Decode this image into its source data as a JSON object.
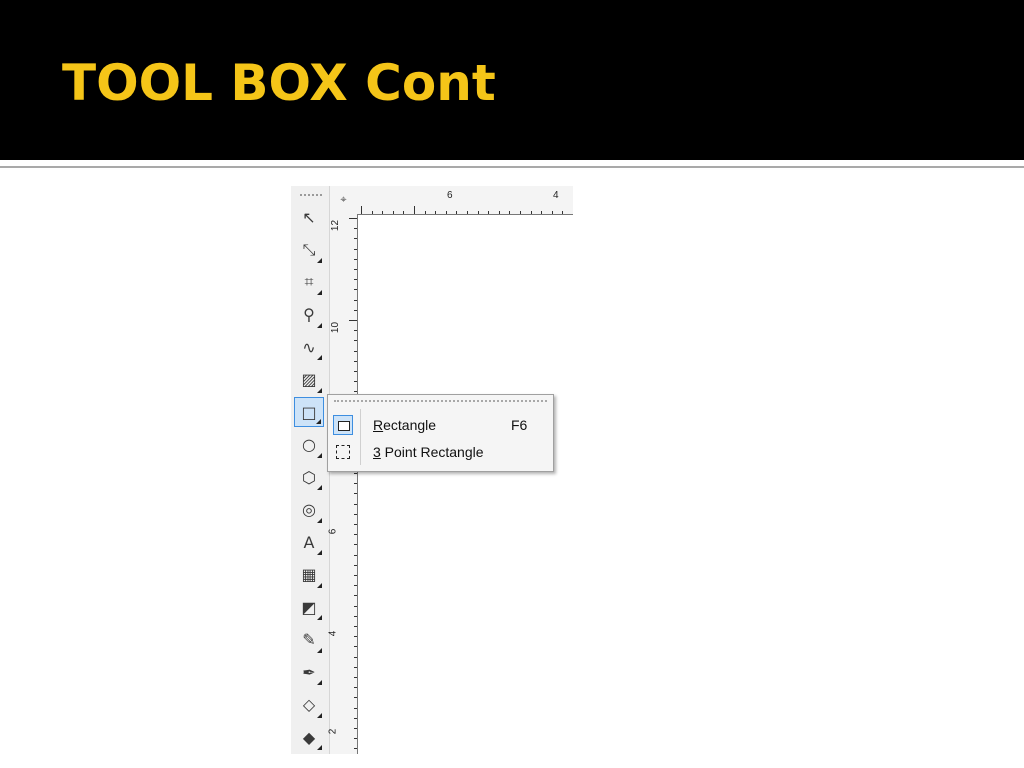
{
  "slide": {
    "title": "TOOL BOX Cont",
    "title_color": "#f5c518",
    "header_bg": "#000000"
  },
  "toolbox": {
    "tools": [
      {
        "name": "pick-tool",
        "icon": "arrow-pointer-icon",
        "glyph": "↖"
      },
      {
        "name": "shape-tool",
        "icon": "shape-edit-icon",
        "glyph": "⤡"
      },
      {
        "name": "crop-tool",
        "icon": "crop-icon",
        "glyph": "⌗"
      },
      {
        "name": "zoom-tool",
        "icon": "magnifier-icon",
        "glyph": "⚲"
      },
      {
        "name": "freehand-tool",
        "icon": "freehand-icon",
        "glyph": "∿"
      },
      {
        "name": "smart-fill-tool",
        "icon": "smart-fill-icon",
        "glyph": "▨"
      },
      {
        "name": "rectangle-tool",
        "icon": "rectangle-icon",
        "glyph": "□"
      },
      {
        "name": "ellipse-tool",
        "icon": "ellipse-icon",
        "glyph": "○"
      },
      {
        "name": "polygon-tool",
        "icon": "polygon-icon",
        "glyph": "⬡"
      },
      {
        "name": "basic-shapes-tool",
        "icon": "basic-shapes-icon",
        "glyph": "◎"
      },
      {
        "name": "text-tool",
        "icon": "text-icon",
        "glyph": "A"
      },
      {
        "name": "table-tool",
        "icon": "table-icon",
        "glyph": "▦"
      },
      {
        "name": "interactive-blend-tool",
        "icon": "blend-icon",
        "glyph": "◩"
      },
      {
        "name": "eyedropper-tool",
        "icon": "eyedropper-icon",
        "glyph": "✎"
      },
      {
        "name": "outline-tool",
        "icon": "pen-nib-icon",
        "glyph": "✒"
      },
      {
        "name": "fill-tool",
        "icon": "paint-bucket-icon",
        "glyph": "◇"
      },
      {
        "name": "interactive-fill-tool",
        "icon": "interactive-fill-icon",
        "glyph": "◆"
      }
    ]
  },
  "rulers": {
    "horizontal_labels": [
      "6",
      "4"
    ],
    "vertical_labels": [
      "12",
      "10",
      "6",
      "4",
      "2"
    ]
  },
  "flyout_menu": {
    "items": [
      {
        "mnemonic": "R",
        "rest": "ectangle",
        "shortcut": "F6",
        "icon": "rectangle-icon"
      },
      {
        "mnemonic": "3",
        "rest": " Point Rectangle",
        "shortcut": "",
        "icon": "three-point-rectangle-icon"
      }
    ]
  }
}
